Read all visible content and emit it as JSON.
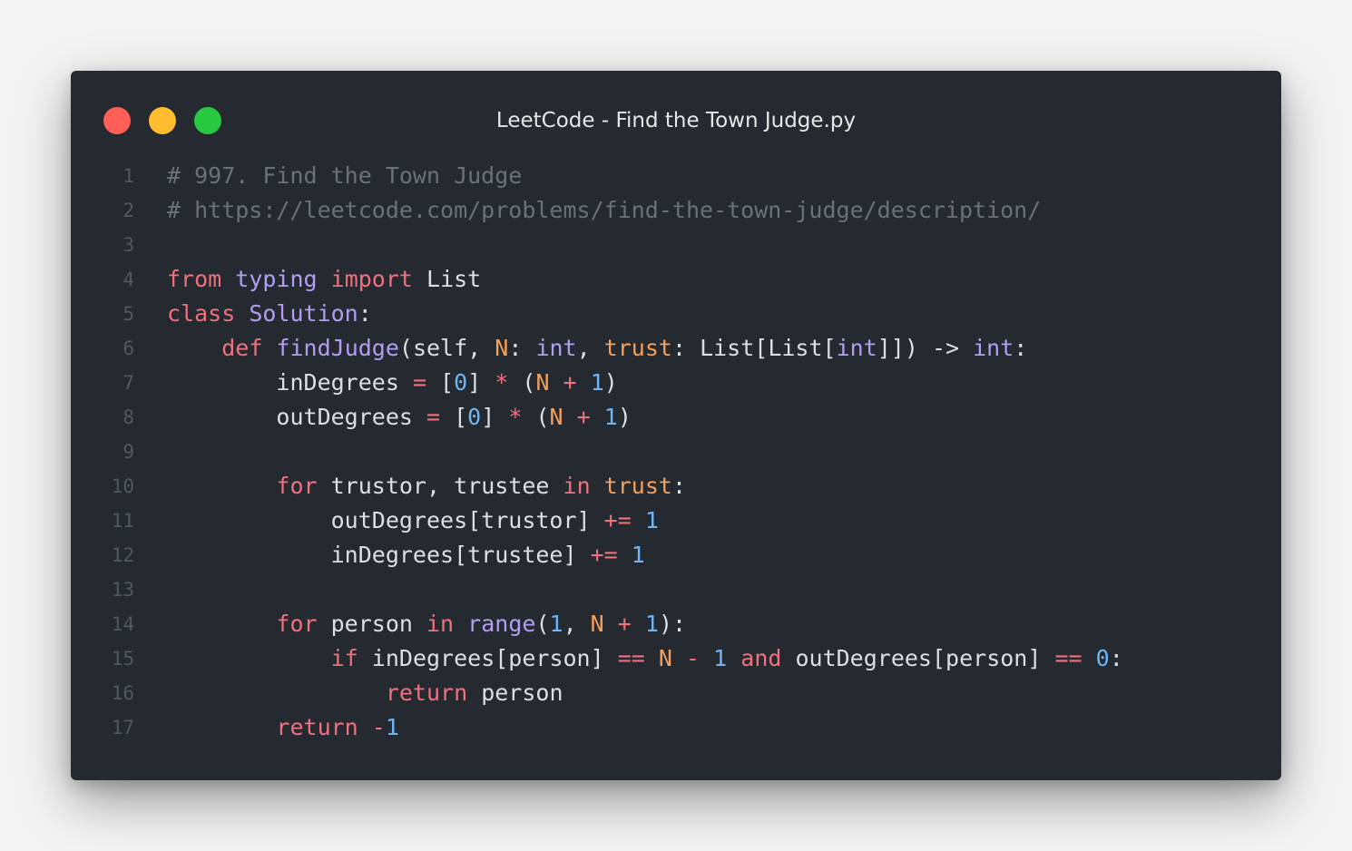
{
  "window": {
    "title": "LeetCode - Find the Town Judge.py",
    "controls": [
      {
        "name": "close",
        "color": "#ff5f57"
      },
      {
        "name": "minimize",
        "color": "#febc2e"
      },
      {
        "name": "zoom",
        "color": "#28c840"
      }
    ]
  },
  "colors": {
    "comment": "#6b7178",
    "keyword": "#f0707e",
    "builtin": "#b39df3",
    "param": "#f5a05b",
    "number": "#6fb4f5",
    "text": "#dcdfe4",
    "line_number": "#52585f",
    "background": "#252a30"
  },
  "code": {
    "lines": [
      {
        "n": "1",
        "tokens": [
          {
            "t": "# 997. Find the Town Judge",
            "c": "comment"
          }
        ]
      },
      {
        "n": "2",
        "tokens": [
          {
            "t": "# https://leetcode.com/problems/find-the-town-judge/description/",
            "c": "comment"
          }
        ]
      },
      {
        "n": "3",
        "tokens": []
      },
      {
        "n": "4",
        "tokens": [
          {
            "t": "from",
            "c": "keyword"
          },
          {
            "t": " "
          },
          {
            "t": "typing",
            "c": "builtin"
          },
          {
            "t": " "
          },
          {
            "t": "import",
            "c": "keyword"
          },
          {
            "t": " List"
          }
        ]
      },
      {
        "n": "5",
        "tokens": [
          {
            "t": "class",
            "c": "keyword"
          },
          {
            "t": " "
          },
          {
            "t": "Solution",
            "c": "builtin"
          },
          {
            "t": ":"
          }
        ]
      },
      {
        "n": "6",
        "tokens": [
          {
            "t": "    "
          },
          {
            "t": "def",
            "c": "keyword"
          },
          {
            "t": " "
          },
          {
            "t": "findJudge",
            "c": "builtin"
          },
          {
            "t": "(self, "
          },
          {
            "t": "N",
            "c": "param"
          },
          {
            "t": ": "
          },
          {
            "t": "int",
            "c": "builtin"
          },
          {
            "t": ", "
          },
          {
            "t": "trust",
            "c": "param"
          },
          {
            "t": ": List[List["
          },
          {
            "t": "int",
            "c": "builtin"
          },
          {
            "t": "]]) -> "
          },
          {
            "t": "int",
            "c": "builtin"
          },
          {
            "t": ":"
          }
        ]
      },
      {
        "n": "7",
        "tokens": [
          {
            "t": "        inDegrees "
          },
          {
            "t": "=",
            "c": "keyword"
          },
          {
            "t": " ["
          },
          {
            "t": "0",
            "c": "number"
          },
          {
            "t": "] "
          },
          {
            "t": "*",
            "c": "keyword"
          },
          {
            "t": " ("
          },
          {
            "t": "N",
            "c": "param"
          },
          {
            "t": " "
          },
          {
            "t": "+",
            "c": "keyword"
          },
          {
            "t": " "
          },
          {
            "t": "1",
            "c": "number"
          },
          {
            "t": ")"
          }
        ]
      },
      {
        "n": "8",
        "tokens": [
          {
            "t": "        outDegrees "
          },
          {
            "t": "=",
            "c": "keyword"
          },
          {
            "t": " ["
          },
          {
            "t": "0",
            "c": "number"
          },
          {
            "t": "] "
          },
          {
            "t": "*",
            "c": "keyword"
          },
          {
            "t": " ("
          },
          {
            "t": "N",
            "c": "param"
          },
          {
            "t": " "
          },
          {
            "t": "+",
            "c": "keyword"
          },
          {
            "t": " "
          },
          {
            "t": "1",
            "c": "number"
          },
          {
            "t": ")"
          }
        ]
      },
      {
        "n": "9",
        "tokens": []
      },
      {
        "n": "10",
        "tokens": [
          {
            "t": "        "
          },
          {
            "t": "for",
            "c": "keyword"
          },
          {
            "t": " trustor, trustee "
          },
          {
            "t": "in",
            "c": "keyword"
          },
          {
            "t": " "
          },
          {
            "t": "trust",
            "c": "param"
          },
          {
            "t": ":"
          }
        ]
      },
      {
        "n": "11",
        "tokens": [
          {
            "t": "            outDegrees[trustor] "
          },
          {
            "t": "+=",
            "c": "keyword"
          },
          {
            "t": " "
          },
          {
            "t": "1",
            "c": "number"
          }
        ]
      },
      {
        "n": "12",
        "tokens": [
          {
            "t": "            inDegrees[trustee] "
          },
          {
            "t": "+=",
            "c": "keyword"
          },
          {
            "t": " "
          },
          {
            "t": "1",
            "c": "number"
          }
        ]
      },
      {
        "n": "13",
        "tokens": []
      },
      {
        "n": "14",
        "tokens": [
          {
            "t": "        "
          },
          {
            "t": "for",
            "c": "keyword"
          },
          {
            "t": " person "
          },
          {
            "t": "in",
            "c": "keyword"
          },
          {
            "t": " "
          },
          {
            "t": "range",
            "c": "builtin"
          },
          {
            "t": "("
          },
          {
            "t": "1",
            "c": "number"
          },
          {
            "t": ", "
          },
          {
            "t": "N",
            "c": "param"
          },
          {
            "t": " "
          },
          {
            "t": "+",
            "c": "keyword"
          },
          {
            "t": " "
          },
          {
            "t": "1",
            "c": "number"
          },
          {
            "t": "):"
          }
        ]
      },
      {
        "n": "15",
        "tokens": [
          {
            "t": "            "
          },
          {
            "t": "if",
            "c": "keyword"
          },
          {
            "t": " inDegrees[person] "
          },
          {
            "t": "==",
            "c": "keyword"
          },
          {
            "t": " "
          },
          {
            "t": "N",
            "c": "param"
          },
          {
            "t": " "
          },
          {
            "t": "-",
            "c": "keyword"
          },
          {
            "t": " "
          },
          {
            "t": "1",
            "c": "number"
          },
          {
            "t": " "
          },
          {
            "t": "and",
            "c": "keyword"
          },
          {
            "t": " outDegrees[person] "
          },
          {
            "t": "==",
            "c": "keyword"
          },
          {
            "t": " "
          },
          {
            "t": "0",
            "c": "number"
          },
          {
            "t": ":"
          }
        ]
      },
      {
        "n": "16",
        "tokens": [
          {
            "t": "                "
          },
          {
            "t": "return",
            "c": "keyword"
          },
          {
            "t": " person"
          }
        ]
      },
      {
        "n": "17",
        "tokens": [
          {
            "t": "        "
          },
          {
            "t": "return",
            "c": "keyword"
          },
          {
            "t": " "
          },
          {
            "t": "-",
            "c": "keyword"
          },
          {
            "t": "1",
            "c": "number"
          }
        ]
      }
    ]
  }
}
